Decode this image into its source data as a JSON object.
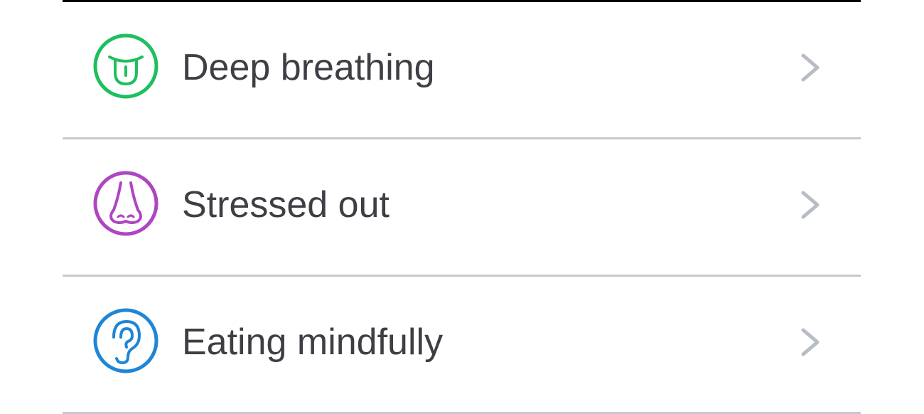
{
  "list": {
    "items": [
      {
        "label": "Deep breathing",
        "icon": "tongue-icon",
        "color": "#1dbf5e"
      },
      {
        "label": "Stressed out",
        "icon": "nose-icon",
        "color": "#ae46c2"
      },
      {
        "label": "Eating mindfully",
        "icon": "ear-icon",
        "color": "#1f86d6"
      }
    ],
    "chevron_color": "#b8bcc4",
    "divider_color": "#c8c9cc",
    "text_color": "#3e3f44"
  }
}
